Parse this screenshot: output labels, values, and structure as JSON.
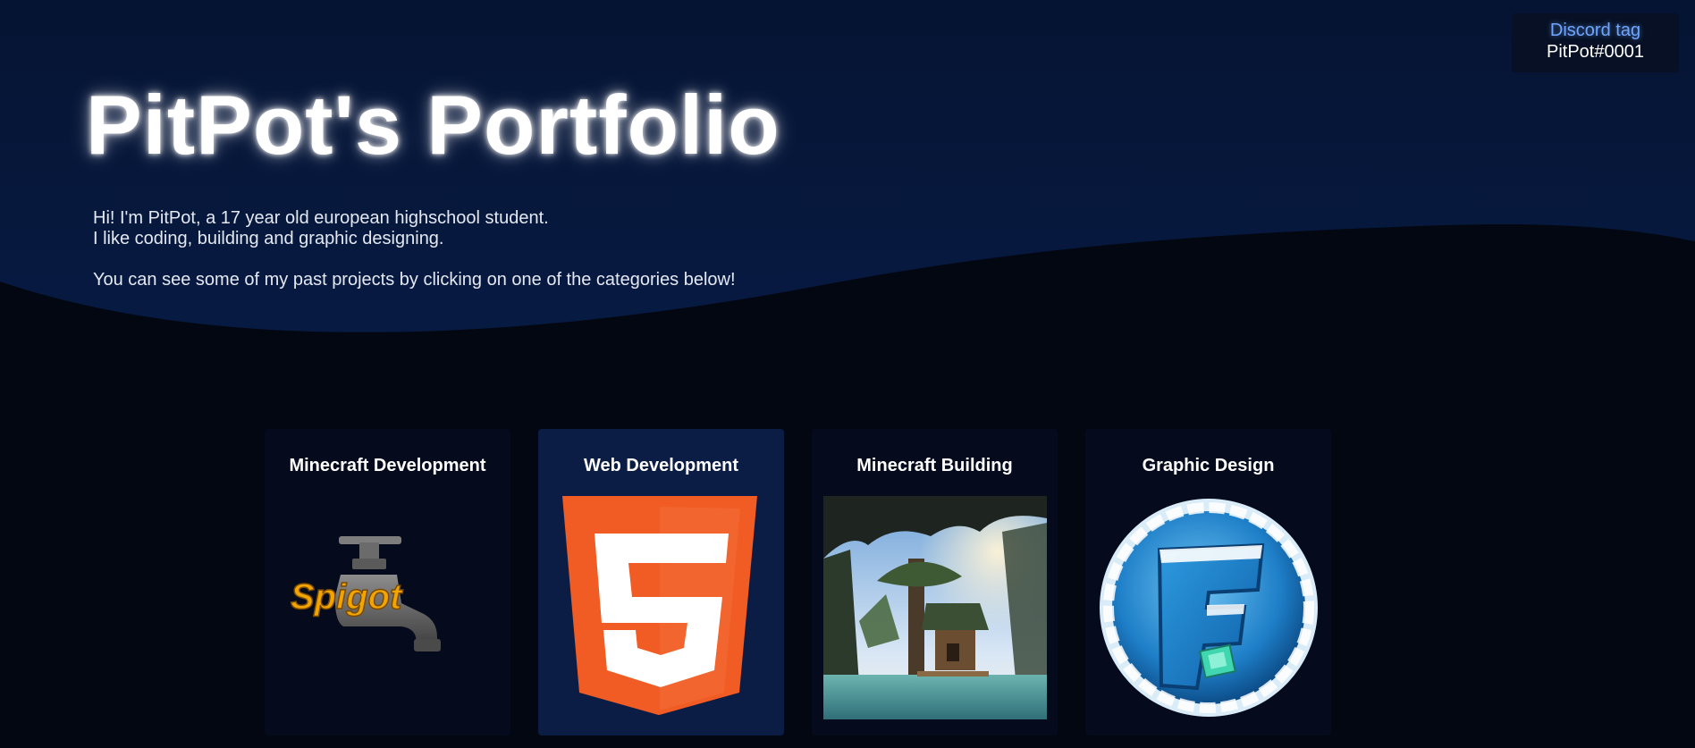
{
  "discord": {
    "label": "Discord tag",
    "value": "PitPot#0001"
  },
  "hero": {
    "title": "PitPot's Portfolio",
    "intro_line1": "Hi! I'm PitPot, a 17 year old european highschool student.",
    "intro_line2": "I like coding, building and graphic designing.",
    "intro_line3": "You can see some of my past projects by clicking on one of the categories below!"
  },
  "categories": [
    {
      "title": "Minecraft Development",
      "image_text": "Spigot",
      "icon": "spigot-faucet-icon",
      "active": false
    },
    {
      "title": "Web Development",
      "image_text": "5",
      "icon": "html5-logo-icon",
      "active": true
    },
    {
      "title": "Minecraft Building",
      "icon": "minecraft-build-screenshot",
      "active": false
    },
    {
      "title": "Graphic Design",
      "image_text": "F",
      "icon": "snow-globe-f-logo-icon",
      "active": false
    }
  ],
  "colors": {
    "page_bg": "#030712",
    "hero_bg": "#06122e",
    "card_bg": "#050b1c",
    "card_active_bg": "#0c1d45",
    "discord_label": "#6ea6ff",
    "html5_orange": "#f15b24",
    "spigot_gold": "#f2a500"
  }
}
